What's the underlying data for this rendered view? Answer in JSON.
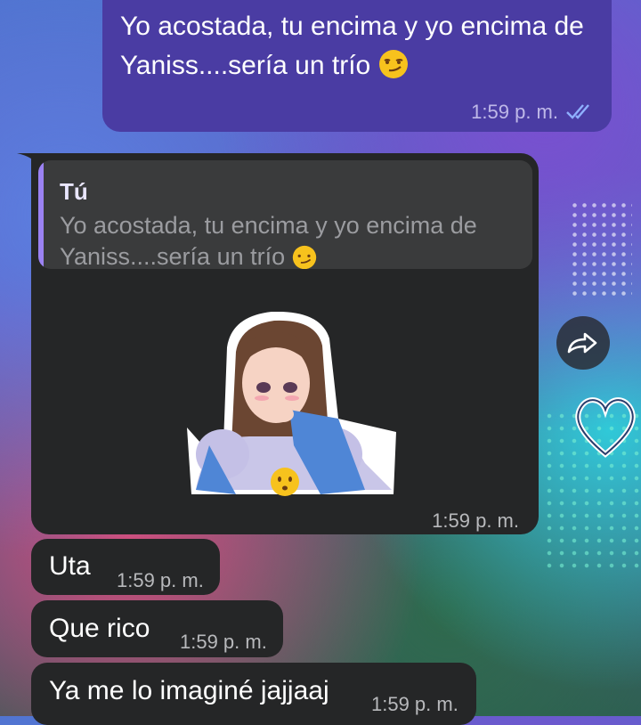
{
  "colors": {
    "outgoing_bubble": "#4a3ca3",
    "incoming_bubble": "#252627",
    "reply_accent": "#9b82f2"
  },
  "outgoing_message": {
    "text": "Yo acostada, tu encima y yo encima de Yaniss....sería un trío",
    "emoji": "smirking-face",
    "time": "1:59 p. m.",
    "status_icon": "double-check-icon"
  },
  "reply_message": {
    "quoted_author": "Tú",
    "quoted_text": "Yo acostada, tu encima y yo encima de Yaniss....sería un trío",
    "quoted_emoji": "smirking-face",
    "sticker_emoji": "hushed-face",
    "time": "1:59 p. m."
  },
  "forward_icon": "forward-icon",
  "messages": [
    {
      "text": "Uta",
      "time": "1:59 p. m."
    },
    {
      "text": "Que rico",
      "time": "1:59 p. m."
    },
    {
      "text": "Ya me lo imaginé jajjaaj",
      "time": "1:59 p. m."
    }
  ]
}
